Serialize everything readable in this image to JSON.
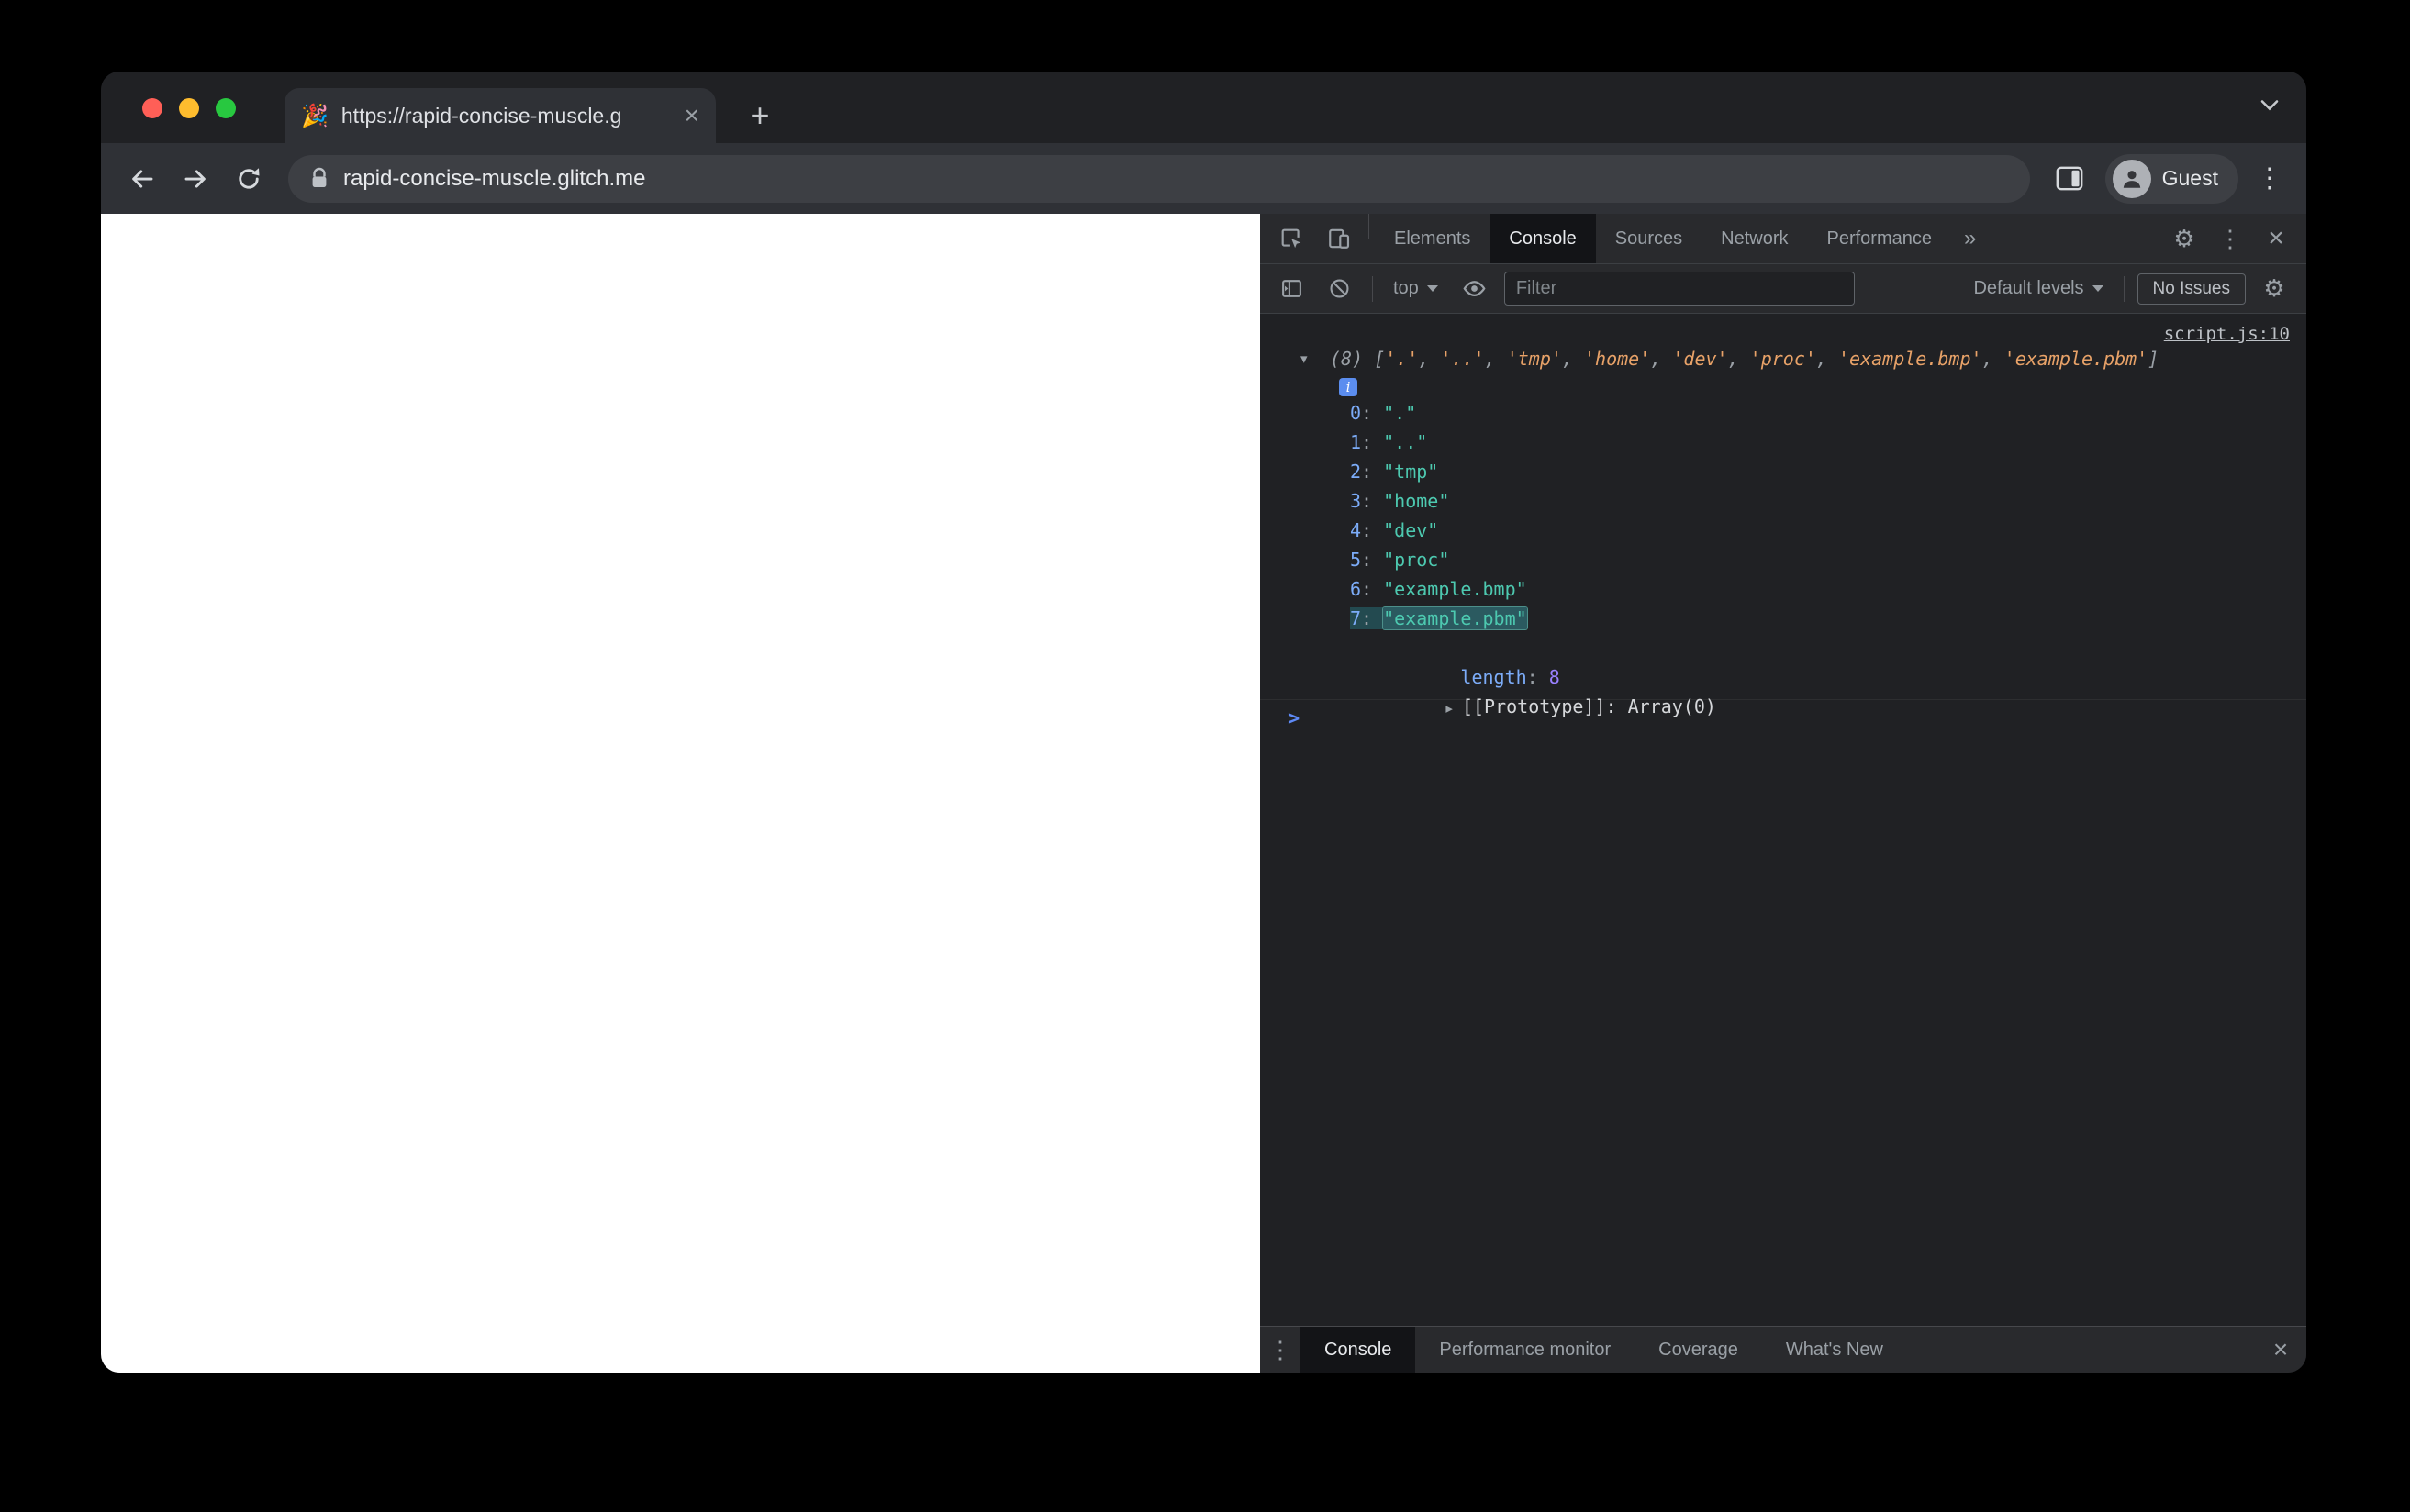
{
  "colors": {
    "traffic_red": "#ff5f57",
    "traffic_yellow": "#febc2e",
    "traffic_green": "#28c840",
    "string_preview": "#e8a268",
    "string_value": "#4dc9b0",
    "property_name": "#7cacf8",
    "number_value": "#9980ff",
    "link": "#bdc1c6",
    "info_badge": "#5b8def",
    "prompt": "#5e8af7",
    "highlight_bg": "#234a50",
    "highlight_border": "#4d8f8a"
  },
  "icons": {
    "gear": "⚙",
    "kebab": "⋮",
    "close": "×",
    "more_tabs": "»",
    "new_tab": "+",
    "tri_down": "▾",
    "tri_right": "▸",
    "info": "i",
    "favicon": "🎉"
  },
  "browser": {
    "tab_title": "https://rapid-concise-muscle.g",
    "url": "rapid-concise-muscle.glitch.me",
    "profile": "Guest"
  },
  "devtools": {
    "panel_tabs": [
      "Elements",
      "Console",
      "Sources",
      "Network",
      "Performance"
    ],
    "active_panel": "Console",
    "console_toolbar": {
      "context_selector": "top",
      "filter_placeholder": "Filter",
      "levels_selector": "Default levels",
      "issues_label": "No Issues"
    },
    "console": {
      "source_link": "script.js:10",
      "array_count": "(8)",
      "preview_open": "[",
      "preview_close": "]",
      "preview_items": [
        "'.'",
        "'..'",
        "'tmp'",
        "'home'",
        "'dev'",
        "'proc'",
        "'example.bmp'",
        "'example.pbm'"
      ],
      "entries": [
        "\".\"",
        "\"..\"",
        "\"tmp\"",
        "\"home\"",
        "\"dev\"",
        "\"proc\"",
        "\"example.bmp\"",
        "\"example.pbm\""
      ],
      "highlighted_index": 7,
      "length_label": "length",
      "length_value": "8",
      "prototype_label": "[[Prototype]]",
      "prototype_separator": ": ",
      "prototype_value": "Array(0)",
      "prompt": ">"
    },
    "drawer_tabs": [
      "Console",
      "Performance monitor",
      "Coverage",
      "What's New"
    ],
    "drawer_active": "Console"
  }
}
